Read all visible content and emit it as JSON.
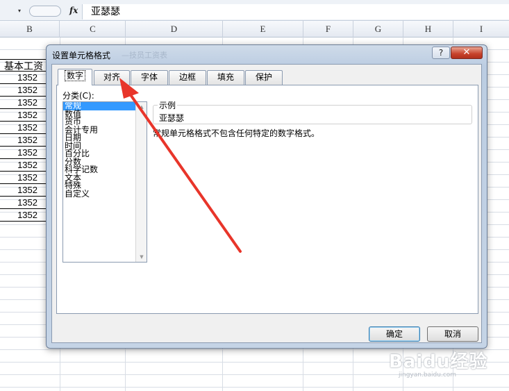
{
  "formula_bar": {
    "name_box_dropdown": "▾",
    "fx_label": "fx",
    "content": "亚瑟瑟"
  },
  "columns": [
    "B",
    "C",
    "D",
    "E",
    "F",
    "G",
    "H",
    "I"
  ],
  "column_b": {
    "header": "基本工资",
    "values": [
      "1352",
      "1352",
      "1352",
      "1352",
      "1352",
      "1352",
      "1352",
      "1352",
      "1352",
      "1352",
      "1352",
      "1352"
    ]
  },
  "dialog": {
    "title": "设置单元格格式",
    "ghost_title": "—技员工资表",
    "help_label": "?",
    "close_label": "✕",
    "tabs": [
      "数字",
      "对齐",
      "字体",
      "边框",
      "填充",
      "保护"
    ],
    "active_tab": "数字",
    "category_label": "分类(C):",
    "categories": [
      "常规",
      "数值",
      "货币",
      "会计专用",
      "日期",
      "时间",
      "百分比",
      "分数",
      "科学记数",
      "文本",
      "特殊",
      "自定义"
    ],
    "selected_category": "常规",
    "sample_legend": "示例",
    "sample_value": "亚瑟瑟",
    "description": "常规单元格格式不包含任何特定的数字格式。",
    "ok_label": "确定",
    "cancel_label": "取消"
  },
  "watermark": {
    "brand": "Baidu经验",
    "sub": "jingyan.baidu.com"
  },
  "annotation_color": "#e8352a"
}
